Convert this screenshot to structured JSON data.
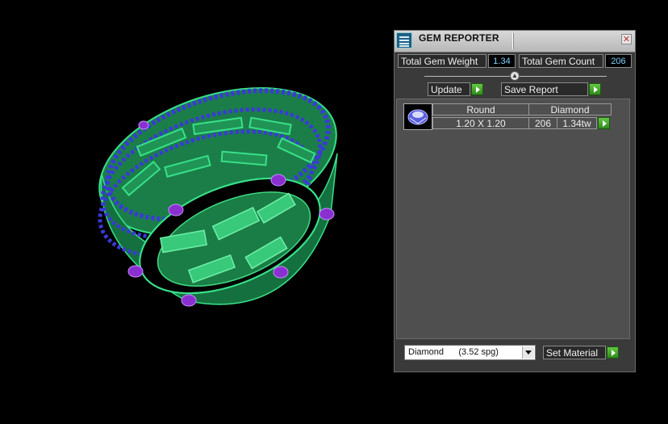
{
  "viewport": {
    "object": "ring-3d-model"
  },
  "gem_reporter": {
    "title": "GEM REPORTER",
    "close_label": "✕",
    "total_gem_weight_label": "Total Gem Weight",
    "total_gem_weight_value": "1.34",
    "total_gem_count_label": "Total Gem Count",
    "total_gem_count_value": "206",
    "update_label": "Update",
    "save_report_label": "Save Report",
    "rows": [
      {
        "shape": "Round",
        "size": "1.20 X 1.20",
        "material": "Diamond",
        "count": "206",
        "weight": "1.34tw"
      }
    ],
    "material_select": "Diamond      (3.52 spg)",
    "set_material_label": "Set Material"
  },
  "colors": {
    "accent_green": "#3fa526",
    "value_blue": "#7fd3ff",
    "ring_green": "#2fbf6e",
    "gem_blue": "#3a3ad8",
    "prong_purple": "#8a2fd0"
  }
}
